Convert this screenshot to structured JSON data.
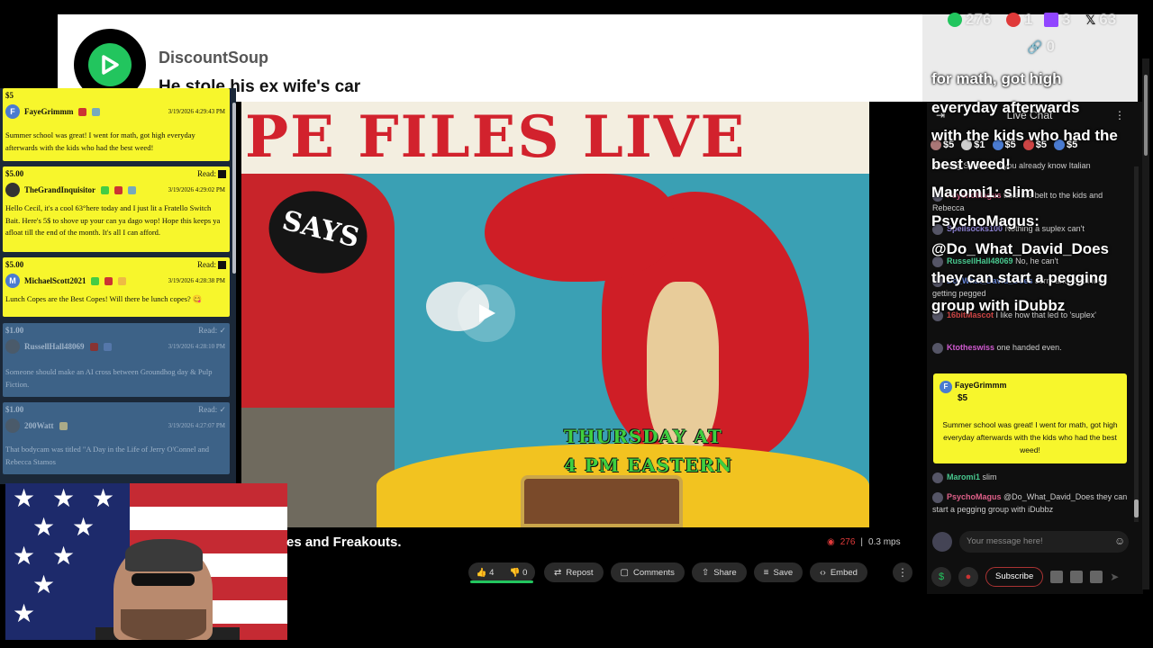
{
  "banner": {
    "name": "DiscountSoup",
    "message": "He stole his ex wife's car",
    "brand_color": "#22c55e"
  },
  "stats": {
    "rumble": "276",
    "locals": "1",
    "twitch": "3",
    "x": "63",
    "link": "0"
  },
  "feed": [
    {
      "amount": "$5",
      "user": "FayeGrimmm",
      "time": "3/19/2026 4:29:43 PM",
      "read": "",
      "text": "Summer school was great! I went for math, got high everyday afterwards with the kids who had the best weed!",
      "color": "yellow",
      "initial": "F"
    },
    {
      "amount": "$5.00",
      "user": "TheGrandInquisitor",
      "time": "3/19/2026 4:29:02 PM",
      "read": "Read:",
      "text": "Hello Cecil, it's a cool 63°here today and I just lit a Fratello Switch Bait. Here's 5$ to shove up your can ya dago wop! Hope this keeps ya afloat till the end of the month. It's all I can afford.",
      "color": "yellow",
      "initial": ""
    },
    {
      "amount": "$5.00",
      "user": "MichaelScott2021",
      "time": "3/19/2026 4:28:38 PM",
      "read": "Read:",
      "text": "Lunch Copes are the Best Copes! Will there be lunch copes? 😋",
      "color": "yellow",
      "initial": "M"
    },
    {
      "amount": "$1.00",
      "user": "RussellHall48069",
      "time": "3/19/2026 4:28:10 PM",
      "read": "Read:",
      "text": "Someone should make an AI cross between Groundhog day & Pulp Fiction.",
      "color": "blue",
      "initial": ""
    },
    {
      "amount": "$1.00",
      "user": "200Watt",
      "time": "3/19/2026 4:27:07 PM",
      "read": "Read:",
      "text": "That bodycam was titled \"A Day in the Life of Jerry O'Connel and Rebecca Stamos",
      "color": "blue",
      "initial": ""
    }
  ],
  "video": {
    "art_title": "PE FILES LIVE",
    "helmet_text": "SAYS",
    "line1": "THURSDAY AT",
    "line2": "4 PM EASTERN",
    "caption": "es and Freakouts.",
    "views": "276",
    "bitrate": "0.3 mps"
  },
  "actions": {
    "likes": "4",
    "dislikes": "0",
    "repost": "Repost",
    "comments": "Comments",
    "share": "Share",
    "save": "Save",
    "embed": "Embed"
  },
  "chat": {
    "title": "Live Chat",
    "tips": [
      "$5",
      "$1",
      "$5",
      "$5",
      "$5"
    ],
    "messages": [
      {
        "user": "",
        "text": "learning Spanish, if you already know Italian"
      },
      {
        "user": "PsychoMagus",
        "text": "take the belt to the kids and Rebecca"
      },
      {
        "user": "Spellsocks100",
        "text": "Nothing a suplex can't"
      },
      {
        "user": "RussellHall48069",
        "text": "No, he can't"
      },
      {
        "user": "Do_What_David_Does",
        "text": "Jerry and Cecil love getting pegged"
      },
      {
        "user": "16bitMascot",
        "text": "I like how that led to 'suplex'"
      },
      {
        "user": "Ktotheswiss",
        "text": "one handed even."
      },
      {
        "user": "Maromi1",
        "text": "slim"
      },
      {
        "user": "PsychoMagus",
        "text": "@Do_What_David_Does they can start a pegging group with iDubbz"
      }
    ],
    "tipcard": {
      "user": "FayeGrimmm",
      "amount": "$5",
      "text": "Summer school was great! I went for math, got high everyday afterwards with the kids who had the best weed!"
    },
    "input_placeholder": "Your message here!",
    "subscribe": "Subscribe"
  },
  "overlay_lines": [
    "for math, got high",
    "everyday afterwards",
    "with the kids who had the",
    "best weed!",
    "Maromi1: slim",
    "PsychoMagus:",
    "@Do_What_David_Does",
    "they can start a pegging",
    "group with iDubbz"
  ]
}
